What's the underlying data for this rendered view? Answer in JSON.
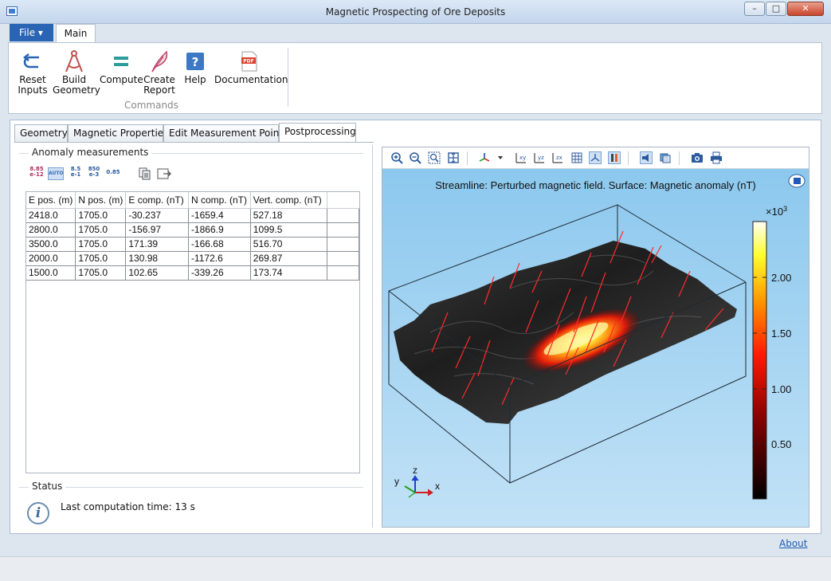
{
  "window": {
    "title": "Magnetic Prospecting of Ore Deposits",
    "minimize": "–",
    "maximize": "□",
    "close": "✕"
  },
  "ribbon": {
    "file_label": "File ▾",
    "main_tab": "Main",
    "group_label": "Commands",
    "buttons": [
      {
        "label": "Reset\nInputs",
        "icon": "reset-arrow-icon"
      },
      {
        "label": "Build\nGeometry",
        "icon": "compass-icon"
      },
      {
        "label": "Compute",
        "icon": "equals-icon"
      },
      {
        "label": "Create\nReport",
        "icon": "feather-icon"
      },
      {
        "label": "Help",
        "icon": "help-icon"
      },
      {
        "label": "Documentation",
        "icon": "pdf-icon"
      }
    ]
  },
  "tabs": [
    "Geometry",
    "Magnetic Properties",
    "Edit Measurement Points",
    "Postprocessing"
  ],
  "active_tab": "Postprocessing",
  "anomaly": {
    "title": "Anomaly measurements",
    "toolbar": [
      {
        "text": "8.85\ne-12",
        "color": "#b0305a"
      },
      {
        "text": "AUTO",
        "color": "#3a6fb8"
      },
      {
        "text": "8.5\ne-1",
        "color": "#2a5a9c"
      },
      {
        "text": "850\ne-3",
        "color": "#2a5a9c"
      },
      {
        "text": "0.85",
        "color": "#2a5a9c"
      }
    ],
    "columns": [
      "E pos. (m)",
      "N pos. (m)",
      "E comp. (nT)",
      "N comp. (nT)",
      "Vert. comp. (nT)"
    ],
    "rows": [
      [
        "2418.0",
        "1705.0",
        "-30.237",
        "-1659.4",
        "527.18"
      ],
      [
        "2800.0",
        "1705.0",
        "-156.97",
        "-1866.9",
        "1099.5"
      ],
      [
        "3500.0",
        "1705.0",
        "171.39",
        "-166.68",
        "516.70"
      ],
      [
        "2000.0",
        "1705.0",
        "130.98",
        "-1172.6",
        "269.87"
      ],
      [
        "1500.0",
        "1705.0",
        "102.65",
        "-339.26",
        "173.74"
      ]
    ]
  },
  "status": {
    "title": "Status",
    "icon": "info-icon",
    "text": "Last computation time: 13 s"
  },
  "graphics": {
    "title": "Streamline: Perturbed magnetic field. Surface: Magnetic anomaly (nT)",
    "colorbar": {
      "exponent_label": "×10",
      "exponent": "3",
      "ticks": [
        "2.00",
        "1.50",
        "1.00",
        "0.50"
      ]
    },
    "axes": {
      "x": "x",
      "y": "y",
      "z": "z"
    }
  },
  "footer": {
    "about": "About"
  }
}
